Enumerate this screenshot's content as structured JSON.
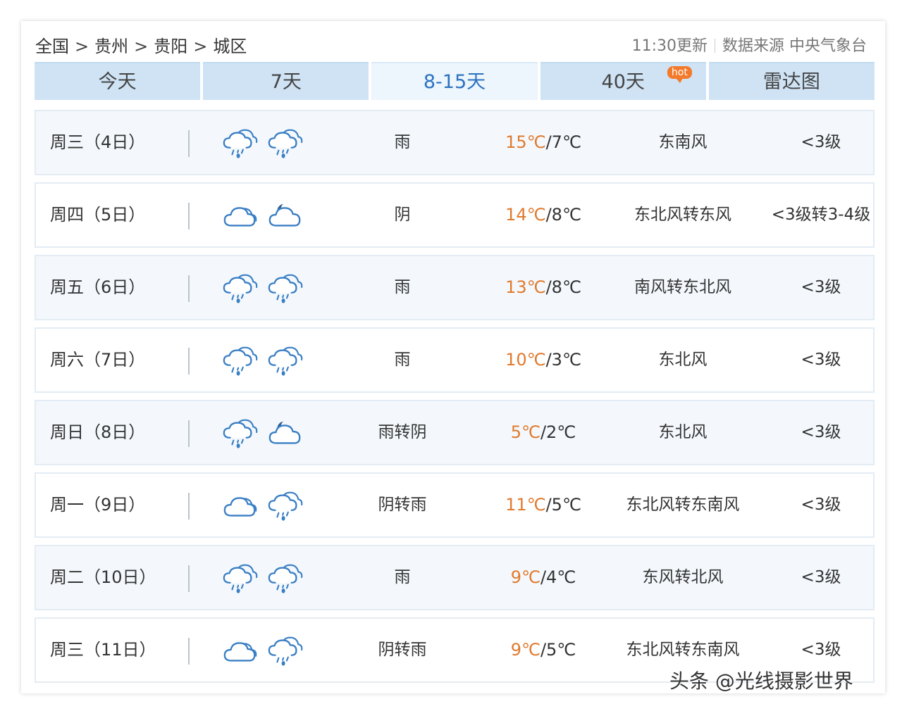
{
  "breadcrumb": [
    "全国",
    "贵州",
    "贵阳",
    "城区"
  ],
  "breadcrumb_separator": ">",
  "update": {
    "time": "11:30更新",
    "source": "数据来源 中央气象台"
  },
  "tabs": [
    {
      "label": "今天"
    },
    {
      "label": "7天"
    },
    {
      "label": "8-15天"
    },
    {
      "label": "40天",
      "badge": "hot"
    },
    {
      "label": "雷达图"
    }
  ],
  "active_tab": "8-15天",
  "colors": {
    "high_temp": "#e07a2e",
    "active_tab_text": "#2b72c0",
    "tab_bg": "#cfe3f5",
    "icon_stroke": "#3a7fc4",
    "hot_badge": "#f47a2b"
  },
  "forecast": [
    {
      "day": "周三（4日）",
      "icon_day": "rain-icon",
      "icon_night": "rain-icon",
      "desc": "雨",
      "high": "15℃",
      "low": "/7℃",
      "wind": "东南风",
      "level": "<3级"
    },
    {
      "day": "周四（5日）",
      "icon_day": "cloudy-icon",
      "icon_night": "cloudy-night-icon",
      "desc": "阴",
      "high": "14℃",
      "low": "/8℃",
      "wind": "东北风转东风",
      "level": "<3级转3-4级"
    },
    {
      "day": "周五（6日）",
      "icon_day": "rain-icon",
      "icon_night": "rain-icon",
      "desc": "雨",
      "high": "13℃",
      "low": "/8℃",
      "wind": "南风转东北风",
      "level": "<3级"
    },
    {
      "day": "周六（7日）",
      "icon_day": "rain-icon",
      "icon_night": "rain-icon",
      "desc": "雨",
      "high": "10℃",
      "low": "/3℃",
      "wind": "东北风",
      "level": "<3级"
    },
    {
      "day": "周日（8日）",
      "icon_day": "rain-icon",
      "icon_night": "cloudy-night-icon",
      "desc": "雨转阴",
      "high": "5℃",
      "low": "/2℃",
      "wind": "东北风",
      "level": "<3级"
    },
    {
      "day": "周一（9日）",
      "icon_day": "cloudy-icon",
      "icon_night": "rain-icon",
      "desc": "阴转雨",
      "high": "11℃",
      "low": "/5℃",
      "wind": "东北风转东南风",
      "level": "<3级"
    },
    {
      "day": "周二（10日）",
      "icon_day": "rain-icon",
      "icon_night": "rain-icon",
      "desc": "雨",
      "high": "9℃",
      "low": "/4℃",
      "wind": "东风转北风",
      "level": "<3级"
    },
    {
      "day": "周三（11日）",
      "icon_day": "cloudy-icon",
      "icon_night": "rain-icon",
      "desc": "阴转雨",
      "high": "9℃",
      "low": "/5℃",
      "wind": "东北风转东南风",
      "level": "<3级"
    }
  ],
  "watermark": "头条 @光线摄影世界"
}
